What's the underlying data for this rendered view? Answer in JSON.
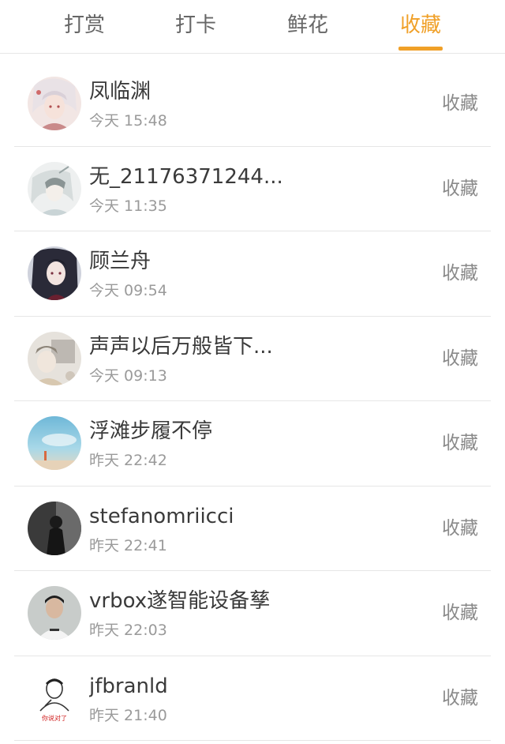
{
  "tabs": [
    {
      "label": "打赏"
    },
    {
      "label": "打卡"
    },
    {
      "label": "鲜花"
    },
    {
      "label": "收藏"
    }
  ],
  "active_tab": "收藏",
  "accent_color": "#f0a028",
  "items": [
    {
      "name": "凤临渊",
      "time": "今天 15:48",
      "action": "收藏",
      "avatar": "anime-white-hair-avatar"
    },
    {
      "name": "无_21176371244...",
      "time": "今天 11:35",
      "action": "收藏",
      "avatar": "anime-sketch-avatar"
    },
    {
      "name": "顾兰舟",
      "time": "今天 09:54",
      "action": "收藏",
      "avatar": "anime-dark-hair-avatar"
    },
    {
      "name": "声声以后万般皆下...",
      "time": "今天 09:13",
      "action": "收藏",
      "avatar": "anime-grey-avatar"
    },
    {
      "name": "浮滩步履不停",
      "time": "昨天 22:42",
      "action": "收藏",
      "avatar": "sky-lighthouse-avatar"
    },
    {
      "name": "stefanomriicci",
      "time": "昨天 22:41",
      "action": "收藏",
      "avatar": "silhouette-person-avatar"
    },
    {
      "name": "vrbox遂智能设备孳",
      "time": "昨天 22:03",
      "action": "收藏",
      "avatar": "young-man-photo-avatar"
    },
    {
      "name": "jfbranld",
      "time": "昨天 21:40",
      "action": "收藏",
      "avatar": "sketch-man-avatar"
    }
  ],
  "avatar_badge_text": "你说对了"
}
